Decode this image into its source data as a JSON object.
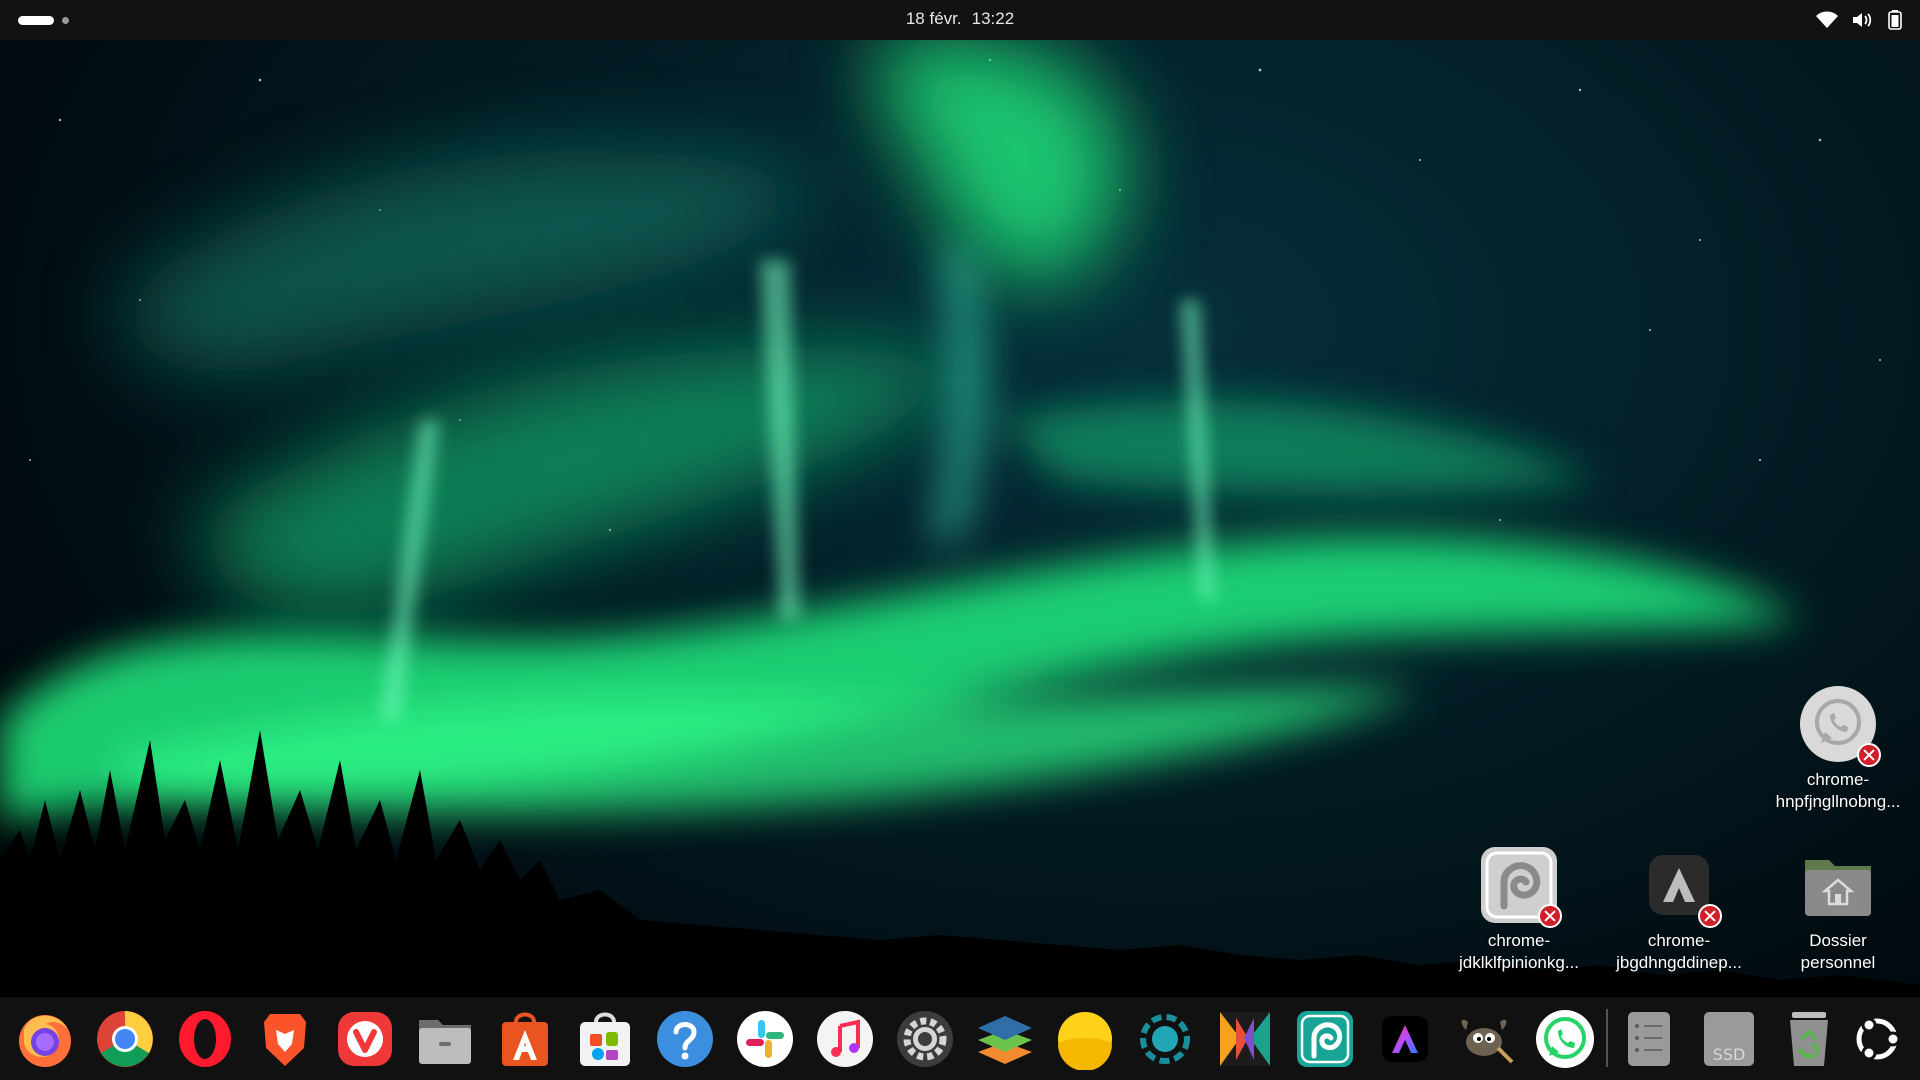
{
  "top_bar": {
    "date": "18 févr.",
    "time": "13:22",
    "tray": {
      "icons": [
        "wifi-icon",
        "volume-icon",
        "battery-icon"
      ]
    }
  },
  "desktop_icons": [
    {
      "id": "chrome-hnpf",
      "label_lines": [
        "chrome-",
        "hnpfjngllnobng..."
      ],
      "icon": "whatsapp-webapp-icon",
      "badge": "error-badge"
    },
    {
      "id": "chrome-jdkl",
      "label_lines": [
        "chrome-",
        "jdklklfpinionkg..."
      ],
      "icon": "photopea-webapp-icon",
      "badge": "error-badge"
    },
    {
      "id": "chrome-jbgd",
      "label_lines": [
        "chrome-",
        "jbgdhngddinep..."
      ],
      "icon": "adobe-express-webapp-icon",
      "badge": "error-badge"
    },
    {
      "id": "home-folder",
      "label_lines": [
        "Dossier",
        "personnel"
      ],
      "icon": "home-folder-icon"
    }
  ],
  "dock": {
    "items": [
      {
        "name": "firefox",
        "icon": "firefox-icon"
      },
      {
        "name": "chrome",
        "icon": "chrome-icon"
      },
      {
        "name": "opera",
        "icon": "opera-icon"
      },
      {
        "name": "brave",
        "icon": "brave-icon"
      },
      {
        "name": "vivaldi",
        "icon": "vivaldi-icon"
      },
      {
        "name": "files",
        "icon": "files-icon"
      },
      {
        "name": "app-center",
        "icon": "app-center-icon"
      },
      {
        "name": "store",
        "icon": "store-icon"
      },
      {
        "name": "help",
        "icon": "help-icon"
      },
      {
        "name": "slack",
        "icon": "slack-icon"
      },
      {
        "name": "music",
        "icon": "music-icon"
      },
      {
        "name": "settings",
        "icon": "settings-gear-icon"
      },
      {
        "name": "layers",
        "icon": "layers-icon"
      },
      {
        "name": "weather",
        "icon": "sun-icon"
      },
      {
        "name": "screen-recorder",
        "icon": "recorder-ring-icon"
      },
      {
        "name": "kolourpaint",
        "icon": "color-blocks-icon"
      },
      {
        "name": "photopea",
        "icon": "photopea-icon"
      },
      {
        "name": "adobe-express",
        "icon": "adobe-express-icon"
      },
      {
        "name": "gimp",
        "icon": "gimp-icon"
      },
      {
        "name": "whatsapp",
        "icon": "whatsapp-icon"
      },
      {
        "name": "drive",
        "icon": "drive-icon"
      },
      {
        "name": "ssd",
        "icon": "ssd-drive-icon",
        "text": "SSD"
      },
      {
        "name": "trash",
        "icon": "trash-icon"
      },
      {
        "name": "show-apps",
        "icon": "ubuntu-apps-icon"
      }
    ]
  },
  "colors": {
    "top_bar": "#121212",
    "aurora_green": "#1fe07a",
    "error_badge": "#d01f2b"
  }
}
